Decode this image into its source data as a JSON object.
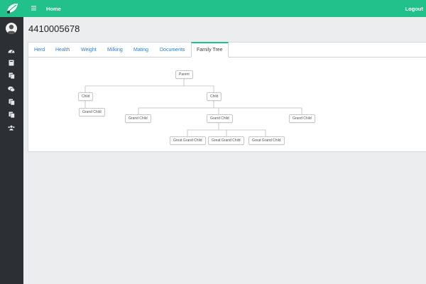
{
  "header": {
    "home_label": "Home",
    "logout_label": "Logout"
  },
  "page": {
    "title": "4410005678"
  },
  "tabs": [
    {
      "label": "Herd"
    },
    {
      "label": "Health"
    },
    {
      "label": "Weight"
    },
    {
      "label": "Milking"
    },
    {
      "label": "Mating"
    },
    {
      "label": "Documents"
    },
    {
      "label": "Family Tree",
      "active": true
    }
  ],
  "sidebar": {
    "icons": [
      "dashboard-icon",
      "book-icon",
      "copy-icon",
      "comments-icon",
      "files-icon",
      "documents-icon",
      "users-icon"
    ]
  },
  "tree": {
    "parent": "Parent",
    "child_1": "Child",
    "child_2": "Child",
    "grand_child_1": "Grand Child",
    "grand_child_2": "Grand Child",
    "grand_child_3": "Grand Child",
    "grand_child_4": "Grand Child",
    "great_grand_child_1": "Great Grand Child",
    "great_grand_child_2": "Great Grand Child",
    "great_grand_child_3": "Great Grand Child"
  },
  "colors": {
    "accent": "#22c08a",
    "sidebar": "#2c3035",
    "link": "#2f7bd0"
  }
}
